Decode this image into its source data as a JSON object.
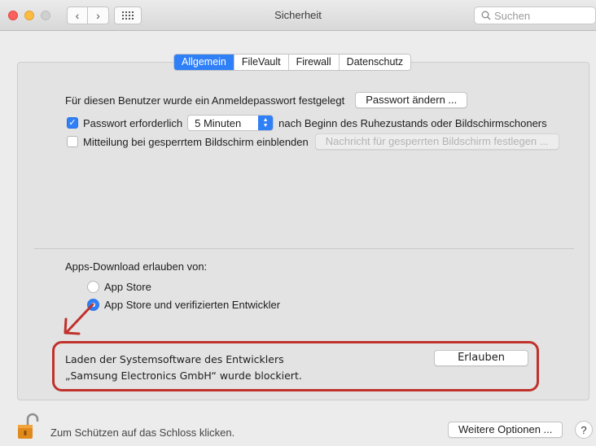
{
  "window": {
    "title": "Sicherheit",
    "search_placeholder": "Suchen"
  },
  "tabs": [
    {
      "label": "Allgemein",
      "active": true
    },
    {
      "label": "FileVault",
      "active": false
    },
    {
      "label": "Firewall",
      "active": false
    },
    {
      "label": "Datenschutz",
      "active": false
    }
  ],
  "general": {
    "password_set_text": "Für diesen Benutzer wurde ein Anmeldepasswort festgelegt",
    "change_password_button": "Passwort ändern ...",
    "require_password_label": "Passwort erforderlich",
    "require_password_checked": true,
    "require_password_delay": "5 Minuten",
    "require_password_suffix": "nach Beginn des Ruhezustands oder Bildschirmschoners",
    "lock_message_label": "Mitteilung bei gesperrtem Bildschirm einblenden",
    "lock_message_checked": false,
    "lock_message_button": "Nachricht für gesperrten Bildschirm festlegen ..."
  },
  "downloads": {
    "heading": "Apps-Download erlauben von:",
    "options": [
      {
        "label": "App Store",
        "selected": false
      },
      {
        "label": "App Store und verifizierten Entwickler",
        "selected": true
      }
    ]
  },
  "blocked": {
    "line1": "Laden der Systemsoftware des Entwicklers",
    "line2": "„Samsung Electronics GmbH“ wurde blockiert.",
    "allow_button": "Erlauben"
  },
  "footer": {
    "lock_text": "Zum Schützen auf das Schloss klicken.",
    "more_options_button": "Weitere Optionen ...",
    "help_label": "?"
  },
  "colors": {
    "accent": "#2f7ff7",
    "highlight_red": "#c0322b"
  }
}
